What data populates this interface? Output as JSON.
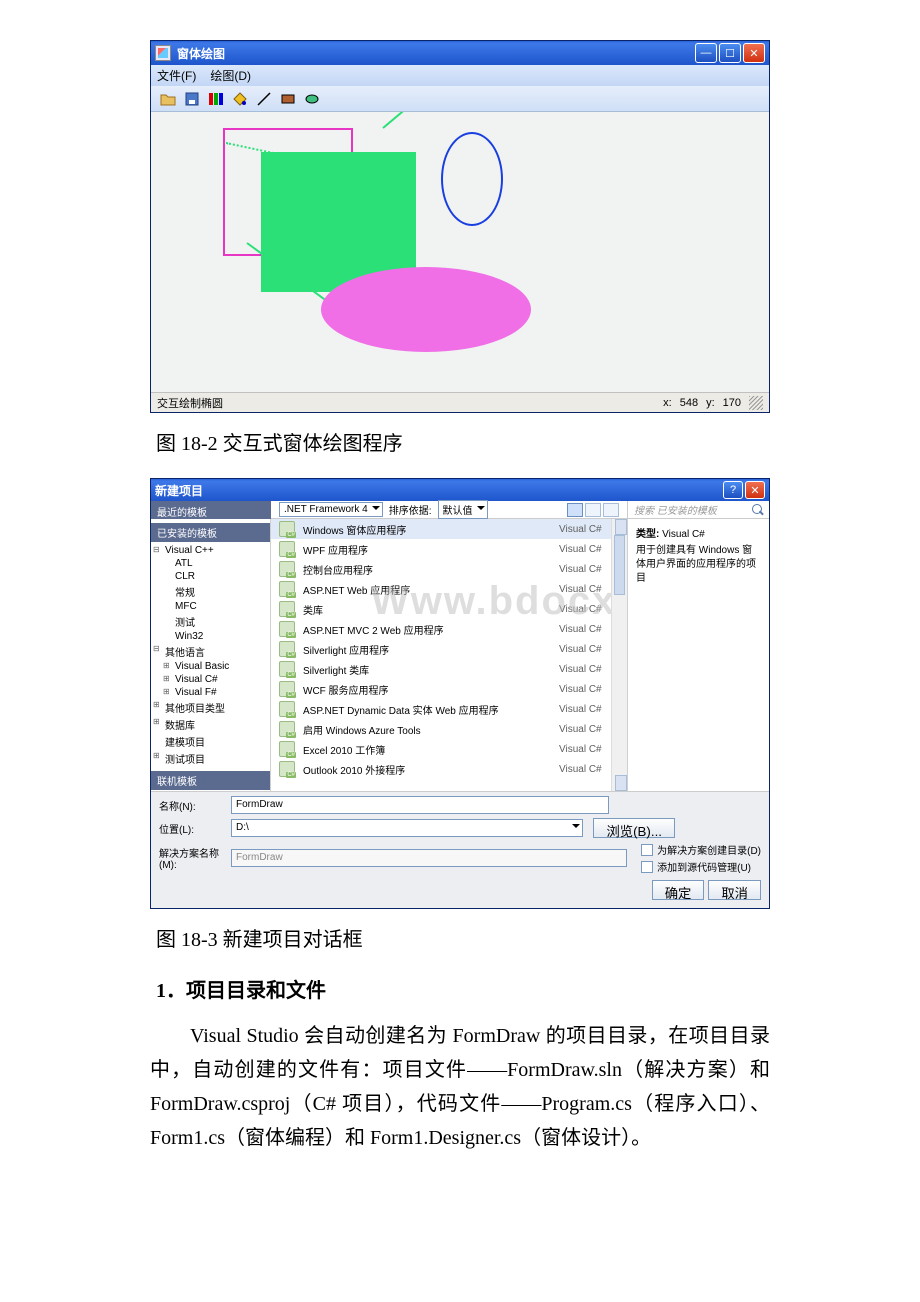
{
  "figure1": {
    "title": "窗体绘图",
    "menu": {
      "file": "文件(F)",
      "draw": "绘图(D)"
    },
    "toolbar_icons": [
      "open-icon",
      "save-icon",
      "color-icon",
      "fill-icon",
      "line-icon",
      "rect-icon",
      "ellipse-icon"
    ],
    "status_text": "交互绘制椭圆",
    "status_coord_x_label": "x:",
    "status_coord_x": "548",
    "status_coord_y_label": "y:",
    "status_coord_y": "170"
  },
  "caption1": "图 18-2 交互式窗体绘图程序",
  "figure2": {
    "title": "新建项目",
    "leftcol_header": "最近的模板",
    "installed_header": "已安装的模板",
    "framework": ".NET Framework 4",
    "sort_label": "排序依据:",
    "sort_value": "默认值",
    "search_placeholder": "搜索 已安装的模板",
    "tree": [
      {
        "text": "Visual C++",
        "lvl": 1,
        "state": "exp"
      },
      {
        "text": "ATL",
        "lvl": 2
      },
      {
        "text": "CLR",
        "lvl": 2
      },
      {
        "text": "常规",
        "lvl": 2
      },
      {
        "text": "MFC",
        "lvl": 2
      },
      {
        "text": "测试",
        "lvl": 2
      },
      {
        "text": "Win32",
        "lvl": 2
      },
      {
        "text": "其他语言",
        "lvl": 1,
        "state": "exp"
      },
      {
        "text": "Visual Basic",
        "lvl": 2,
        "state": "col"
      },
      {
        "text": "Visual C#",
        "lvl": 2,
        "state": "col"
      },
      {
        "text": "Visual F#",
        "lvl": 2,
        "state": "col"
      },
      {
        "text": "其他项目类型",
        "lvl": 1,
        "state": "col"
      },
      {
        "text": "数据库",
        "lvl": 1,
        "state": "col"
      },
      {
        "text": "建模项目",
        "lvl": 1
      },
      {
        "text": "测试项目",
        "lvl": 1,
        "state": "col"
      }
    ],
    "online_header": "联机模板",
    "templates": [
      {
        "name": "Windows 窗体应用程序",
        "lang": "Visual C#",
        "sel": true
      },
      {
        "name": "WPF 应用程序",
        "lang": "Visual C#"
      },
      {
        "name": "控制台应用程序",
        "lang": "Visual C#"
      },
      {
        "name": "ASP.NET Web 应用程序",
        "lang": "Visual C#"
      },
      {
        "name": "类库",
        "lang": "Visual C#"
      },
      {
        "name": "ASP.NET MVC 2 Web 应用程序",
        "lang": "Visual C#"
      },
      {
        "name": "Silverlight 应用程序",
        "lang": "Visual C#"
      },
      {
        "name": "Silverlight 类库",
        "lang": "Visual C#"
      },
      {
        "name": "WCF 服务应用程序",
        "lang": "Visual C#"
      },
      {
        "name": "ASP.NET Dynamic Data 实体 Web 应用程序",
        "lang": "Visual C#"
      },
      {
        "name": "启用 Windows Azure Tools",
        "lang": "Visual C#"
      },
      {
        "name": "Excel 2010 工作簿",
        "lang": "Visual C#"
      },
      {
        "name": "Outlook 2010 外接程序",
        "lang": "Visual C#"
      }
    ],
    "info_type_label": "类型:",
    "info_type_value": "Visual C#",
    "info_desc": "用于创建具有 Windows 窗体用户界面的应用程序的项目",
    "name_label": "名称(N):",
    "name_value": "FormDraw",
    "location_label": "位置(L):",
    "location_value": "D:\\",
    "solution_label": "解决方案名称(M):",
    "solution_value": "FormDraw",
    "browse_label": "浏览(B)...",
    "chk_createdir": "为解决方案创建目录(D)",
    "chk_sourcectl": "添加到源代码管理(U)",
    "ok": "确定",
    "cancel": "取消"
  },
  "caption2": "图 18-3 新建项目对话框",
  "section_heading": "1．项目目录和文件",
  "paragraph": "Visual Studio 会自动创建名为 FormDraw 的项目目录，在项目目录中，自动创建的文件有：项目文件——FormDraw.sln（解决方案）和 FormDraw.csproj（C# 项目），代码文件——Program.cs（程序入口）、Form1.cs（窗体编程）和 Form1.Designer.cs（窗体设计）。",
  "watermark": "Www.bdocx.com"
}
